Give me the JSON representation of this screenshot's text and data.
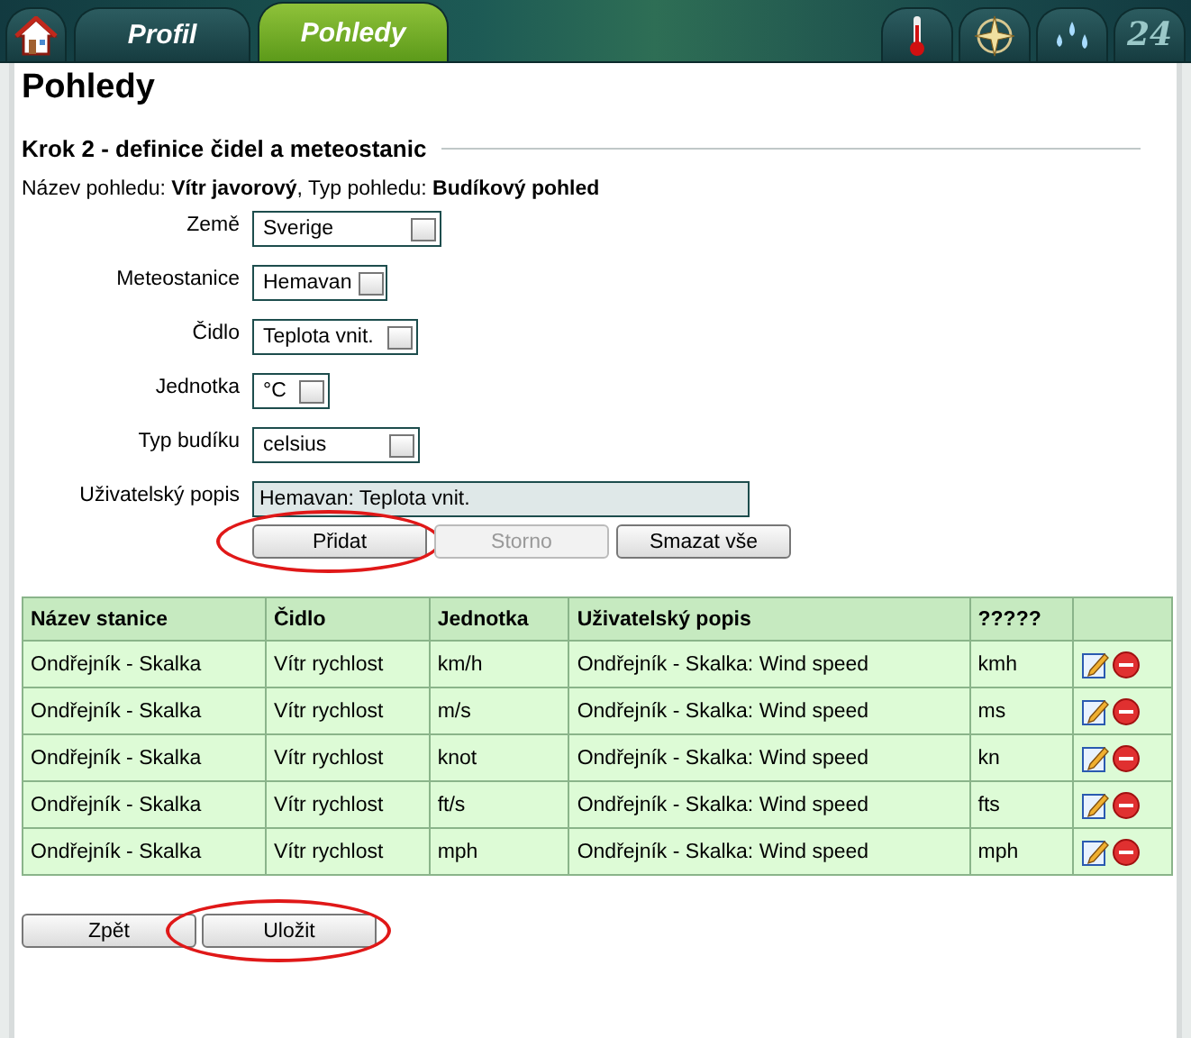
{
  "nav": {
    "tabs": [
      {
        "kind": "home",
        "selected": false
      },
      {
        "kind": "text",
        "label": "Profil",
        "selected": false
      },
      {
        "kind": "text",
        "label": "Pohledy",
        "selected": true
      }
    ],
    "tools": [
      {
        "kind": "thermometer"
      },
      {
        "kind": "compass"
      },
      {
        "kind": "drops"
      },
      {
        "kind": "number",
        "label": "24"
      }
    ]
  },
  "page_title": "Pohledy",
  "step_heading": "Krok 2 - definice čidel a meteostanic",
  "info": "Název pohledu: **Vítr javorový**, Typ pohledu: **Budíkový pohled**",
  "form": {
    "fields": [
      {
        "label": "Země",
        "kind": "select",
        "value": "Sverige"
      },
      {
        "label": "Meteostanice",
        "kind": "select",
        "value": "Hemavan"
      },
      {
        "label": "Čidlo",
        "kind": "select",
        "value": "Teplota vnit."
      },
      {
        "label": "Jednotka",
        "kind": "select",
        "value": "°C"
      },
      {
        "label": "Typ budíku",
        "kind": "select",
        "value": "celsius"
      },
      {
        "label": "Uživatelský popis",
        "kind": "text",
        "value": "Hemavan: Teplota vnit."
      }
    ],
    "buttons": [
      {
        "label": "Přidat",
        "disabled": false,
        "circled": true
      },
      {
        "label": "Storno",
        "disabled": true,
        "circled": false
      },
      {
        "label": "Smazat vše",
        "disabled": false,
        "circled": false
      }
    ]
  },
  "table": {
    "columns": [
      "Název stanice",
      "Čidlo",
      "Jednotka",
      "Uživatelský popis",
      "?????"
    ],
    "rows": [
      {
        "cells": [
          "Ondřejník - Skalka",
          "Vítr rychlost",
          "km/h",
          "Ondřejník - Skalka: Wind speed",
          "kmh"
        ]
      },
      {
        "cells": [
          "Ondřejník - Skalka",
          "Vítr rychlost",
          "m/s",
          "Ondřejník - Skalka: Wind speed",
          "ms"
        ]
      },
      {
        "cells": [
          "Ondřejník - Skalka",
          "Vítr rychlost",
          "knot",
          "Ondřejník - Skalka: Wind speed",
          "kn"
        ]
      },
      {
        "cells": [
          "Ondřejník - Skalka",
          "Vítr rychlost",
          "ft/s",
          "Ondřejník - Skalka: Wind speed",
          "fts"
        ]
      },
      {
        "cells": [
          "Ondřejník - Skalka",
          "Vítr rychlost",
          "mph",
          "Ondřejník - Skalka: Wind speed",
          "mph"
        ]
      }
    ]
  },
  "footer_buttons": [
    {
      "label": "Zpět",
      "disabled": false,
      "circled": false
    },
    {
      "label": "Uložit",
      "disabled": false,
      "circled": true
    }
  ]
}
